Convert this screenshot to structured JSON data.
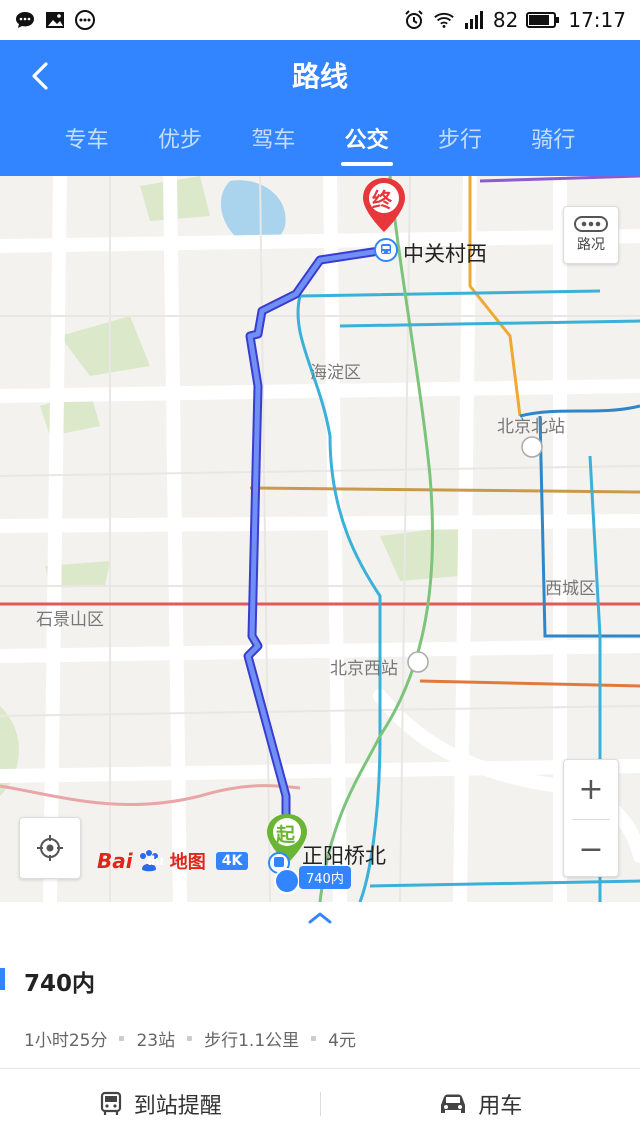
{
  "statusbar": {
    "left_icons": [
      "chat-icon",
      "image-icon",
      "more-icon"
    ],
    "alarm_icon": "alarm-icon",
    "wifi_icon": "wifi-icon",
    "signal_icon": "signal-icon",
    "battery_level": "82",
    "time": "17:17"
  },
  "header": {
    "title": "路线",
    "tabs": [
      {
        "label": "专车",
        "active": false
      },
      {
        "label": "优步",
        "active": false
      },
      {
        "label": "驾车",
        "active": false
      },
      {
        "label": "公交",
        "active": true
      },
      {
        "label": "步行",
        "active": false
      },
      {
        "label": "骑行",
        "active": false
      }
    ],
    "accent_color": "#3385ff"
  },
  "map": {
    "district_labels": [
      "海淀区",
      "西城区",
      "石景山区"
    ],
    "station_labels": [
      "北京北站",
      "北京西站"
    ],
    "destination": {
      "marker": "终",
      "name": "中关村西"
    },
    "origin": {
      "marker": "起",
      "name": "正阳桥北",
      "route_badge": "740内"
    },
    "traffic_label": "路况",
    "zoom_in": "+",
    "zoom_out": "−",
    "logo": {
      "bai": "Bai",
      "du": "du",
      "ditu": "地图",
      "res": "4K"
    }
  },
  "panel": {
    "route_name": "740内",
    "info": [
      "1小时25分",
      "23站",
      "步行1.1公里",
      "4元"
    ],
    "actions": [
      {
        "label": "到站提醒",
        "icon": "bus-icon"
      },
      {
        "label": "用车",
        "icon": "car-icon"
      }
    ]
  }
}
